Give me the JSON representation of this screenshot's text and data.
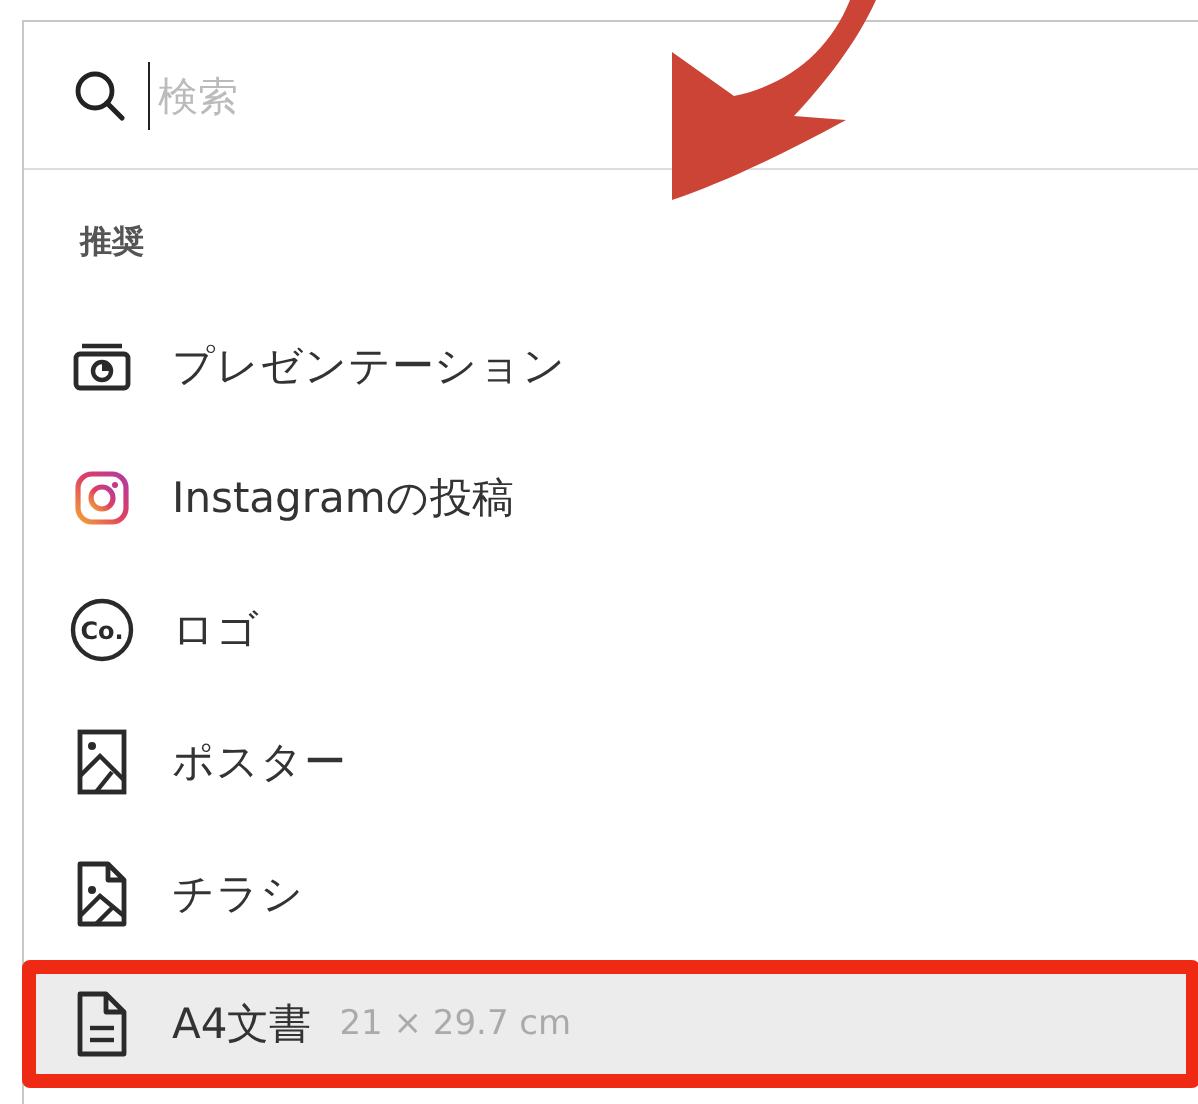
{
  "search": {
    "placeholder": "検索"
  },
  "section": {
    "heading": "推奨"
  },
  "items": [
    {
      "kind": "presentation",
      "label": "プレゼンテーション",
      "selected": false,
      "marked": false
    },
    {
      "kind": "instagram",
      "label": "Instagramの投稿",
      "selected": false,
      "marked": false
    },
    {
      "kind": "logo",
      "label": "ロゴ",
      "icon_text": "Co.",
      "selected": false,
      "marked": false
    },
    {
      "kind": "poster",
      "label": "ポスター",
      "selected": false,
      "marked": false
    },
    {
      "kind": "flyer",
      "label": "チラシ",
      "selected": false,
      "marked": false
    },
    {
      "kind": "document",
      "label": "A4文書",
      "detail": "21 × 29.7 cm",
      "selected": true,
      "marked": true
    }
  ]
}
